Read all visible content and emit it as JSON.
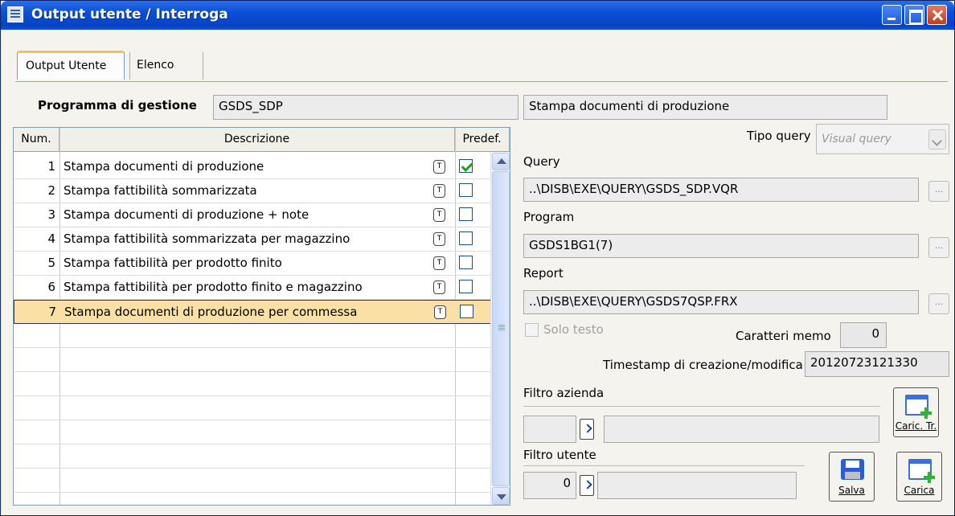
{
  "window": {
    "title": "Output utente / Interroga"
  },
  "tabs": [
    {
      "label": "Output Utente"
    },
    {
      "label": "Elenco"
    }
  ],
  "programma": {
    "label": "Programma di gestione",
    "code": "GSDS_SDP",
    "description": "Stampa documenti di produzione"
  },
  "grid": {
    "headers": {
      "num": "Num.",
      "desc": "Descrizione",
      "predef": "Predef."
    },
    "t_glyph": "T",
    "rows": [
      {
        "num": "1",
        "desc": "Stampa documenti di produzione",
        "predef": true
      },
      {
        "num": "2",
        "desc": "Stampa fattibilità sommarizzata",
        "predef": false
      },
      {
        "num": "3",
        "desc": "Stampa documenti di produzione + note",
        "predef": false
      },
      {
        "num": "4",
        "desc": "Stampa fattibilità sommarizzata per magazzino",
        "predef": false
      },
      {
        "num": "5",
        "desc": "Stampa fattibilità  per prodotto finito",
        "predef": false
      },
      {
        "num": "6",
        "desc": "Stampa fattibilità per prodotto finito e magazzino",
        "predef": false
      },
      {
        "num": "7",
        "desc": "Stampa documenti di produzione per commessa",
        "predef": false,
        "selected": true
      }
    ]
  },
  "right": {
    "tipo_query": {
      "label": "Tipo query",
      "value": "Visual query"
    },
    "query": {
      "label": "Query",
      "value": "..\\DISB\\EXE\\QUERY\\GSDS_SDP.VQR"
    },
    "program": {
      "label": "Program",
      "value": "GSDS1BG1(7)"
    },
    "report": {
      "label": "Report",
      "value": "..\\DISB\\EXE\\QUERY\\GSDS7QSP.FRX"
    },
    "solo_testo": {
      "label": "Solo testo",
      "checked": false
    },
    "caratteri_memo": {
      "label": "Caratteri memo",
      "value": "0"
    },
    "timestamp": {
      "label": "Timestamp di creazione/modifica",
      "value": "20120723121330"
    },
    "filtro_azienda": {
      "label": "Filtro azienda",
      "code": "",
      "description": ""
    },
    "filtro_utente": {
      "label": "Filtro utente",
      "code": "0",
      "description": ""
    },
    "dots_label": "..."
  },
  "buttons": {
    "caric_tr": "Caric. Tr.",
    "salva": "Salva",
    "carica": "Carica"
  },
  "icons": {
    "app": "form-icon",
    "caric_tr": "window-add-icon",
    "salva": "floppy-disk-icon",
    "carica": "window-add-icon"
  }
}
